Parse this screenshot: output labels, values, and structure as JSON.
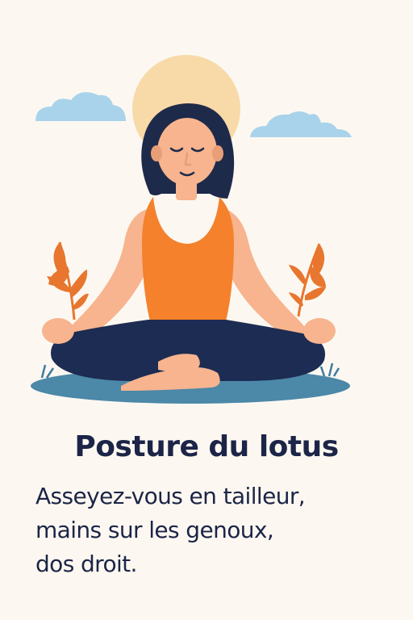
{
  "card": {
    "title": "Posture du lotus",
    "description_lines": [
      "Asseyez-vous en tailleur,",
      "mains sur les genoux,",
      "dos droit."
    ]
  },
  "colors": {
    "background": "#FCF8F1",
    "text": "#1C2547",
    "sun": "#F8D9A8",
    "cloud": "#A9D3EA",
    "hair": "#1E2A4A",
    "skin": "#F7B48E",
    "skin_shadow": "#E89F78",
    "top": "#F5812C",
    "pants": "#1D2C52",
    "mat": "#4C88A8",
    "leaf": "#E8762F",
    "grass": "#3E7BA0"
  },
  "icons": {
    "sun": "sun-icon",
    "cloud_left": "cloud-icon",
    "cloud_right": "cloud-icon",
    "plant_left": "leaf-icon",
    "plant_right": "leaf-icon"
  }
}
